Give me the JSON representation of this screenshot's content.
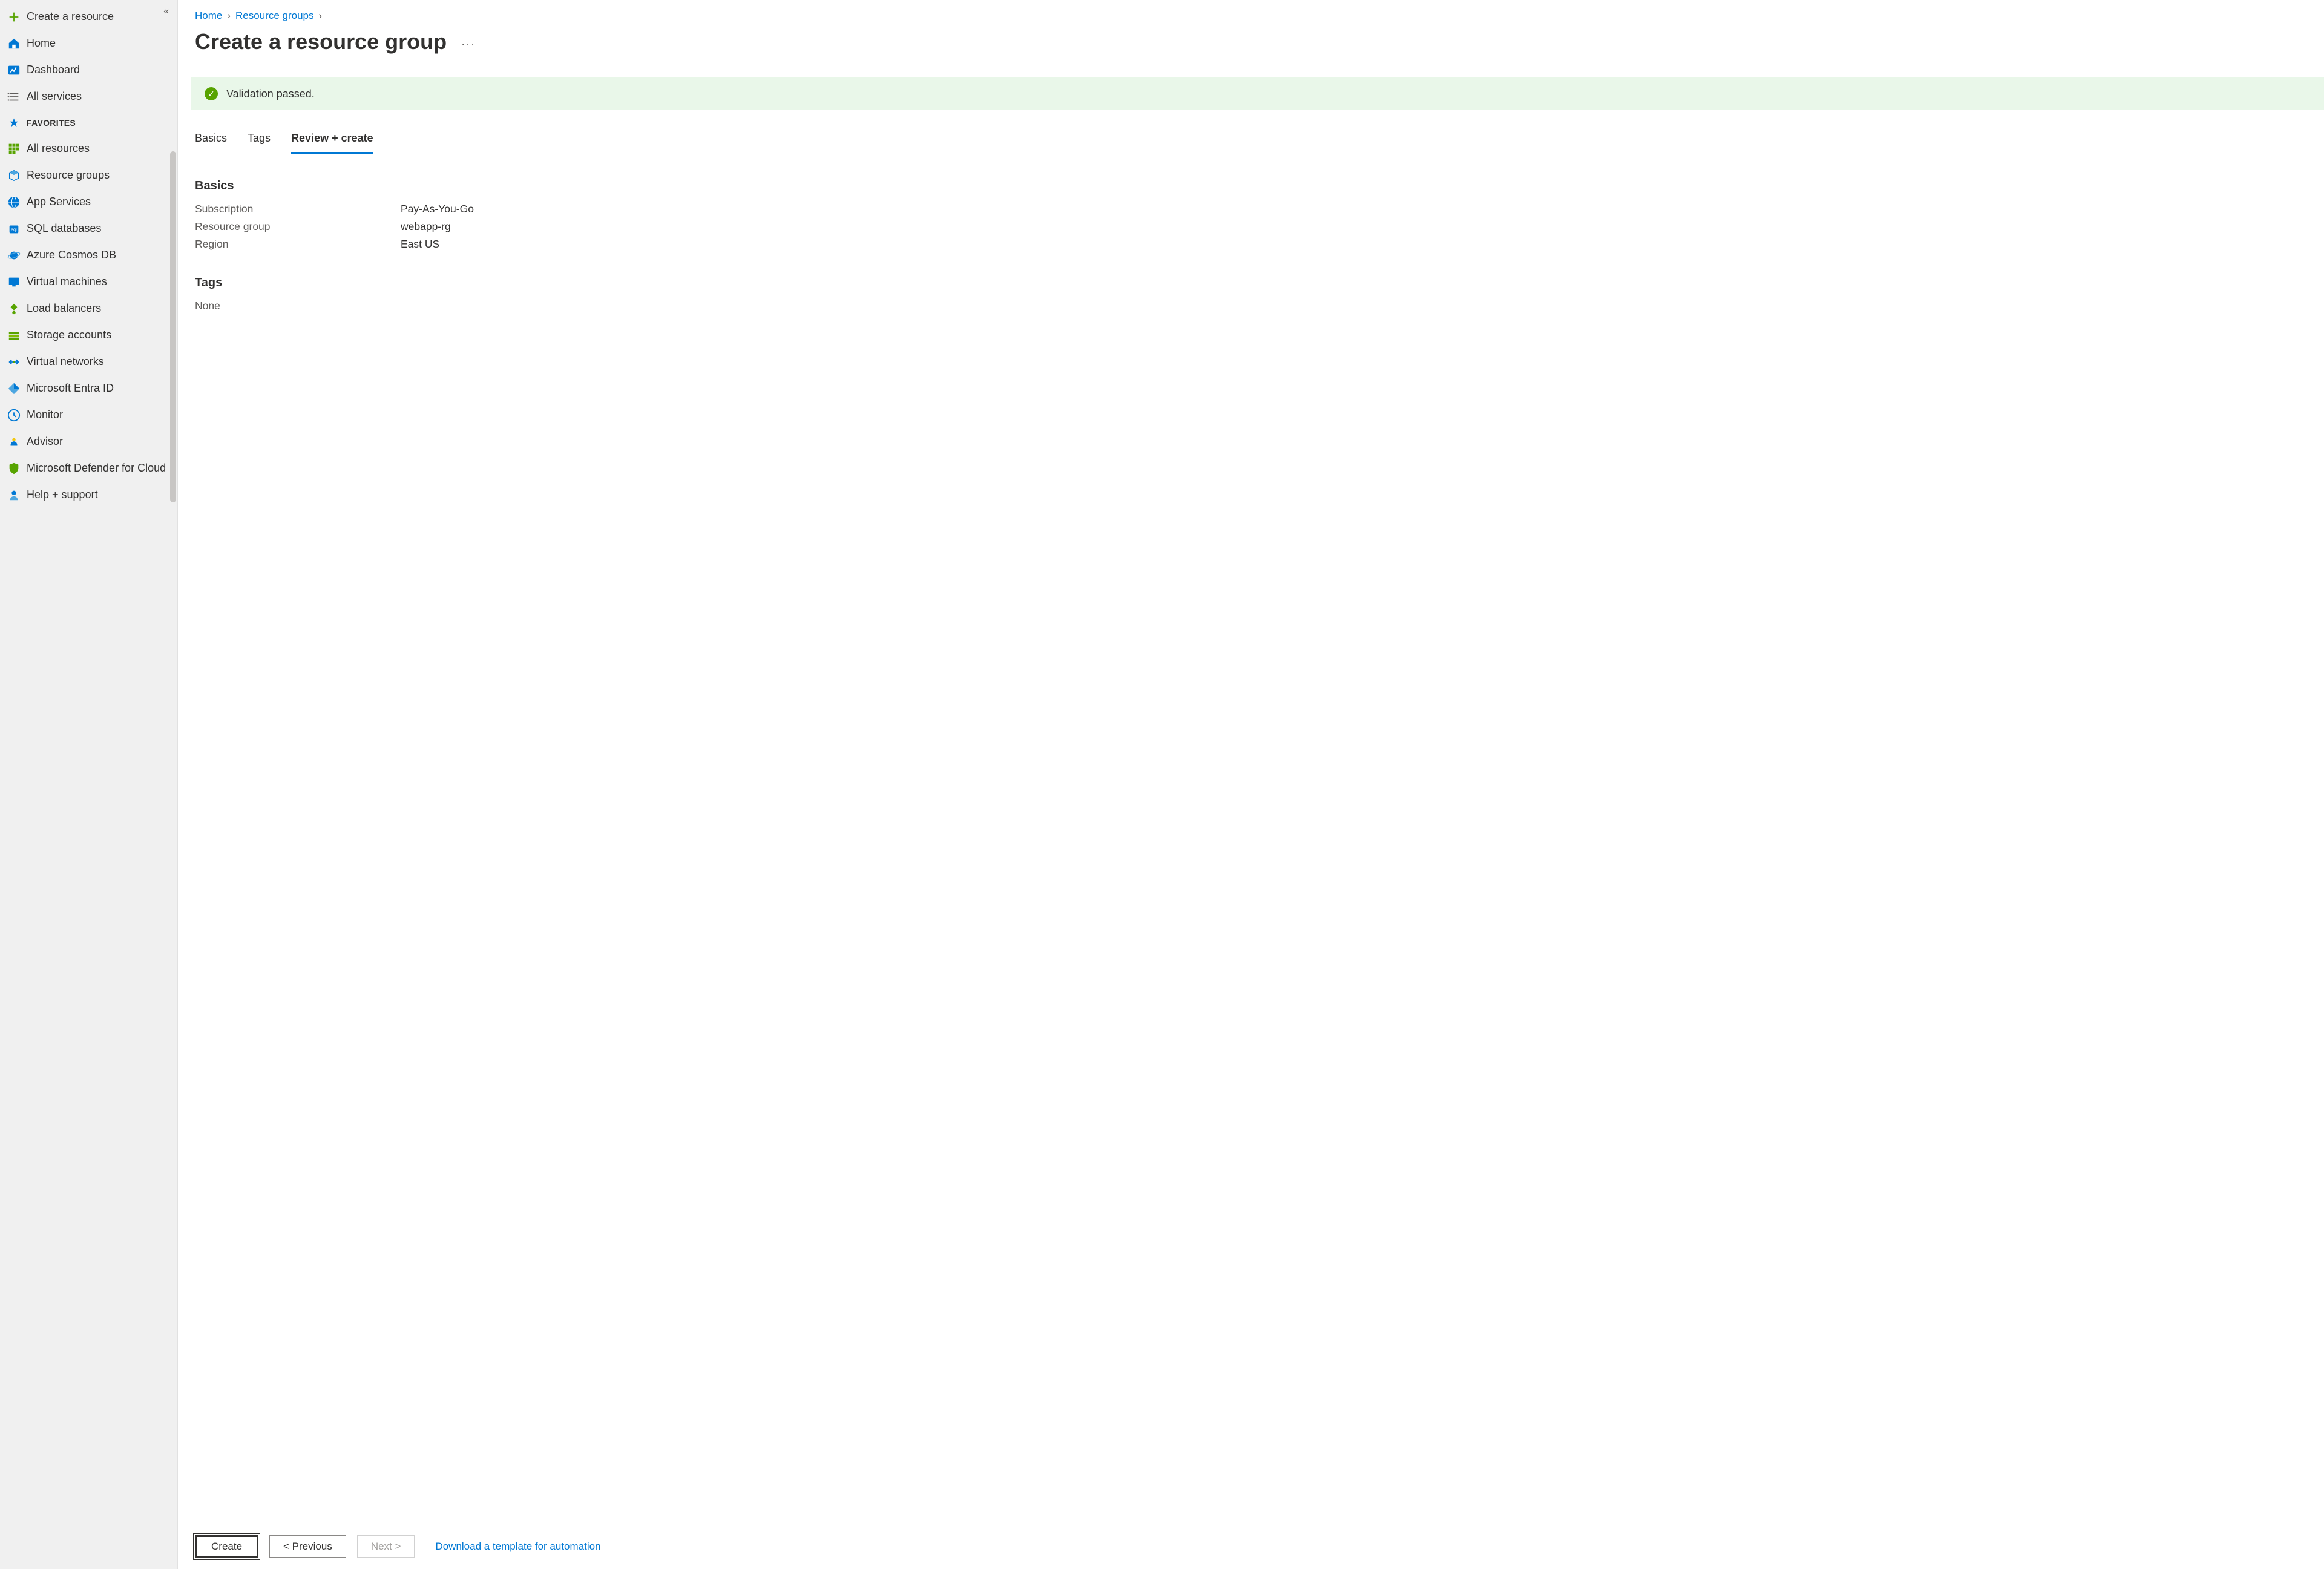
{
  "sidebar": {
    "top": [
      {
        "label": "Create a resource",
        "icon": "plus"
      },
      {
        "label": "Home",
        "icon": "home"
      },
      {
        "label": "Dashboard",
        "icon": "dashboard"
      },
      {
        "label": "All services",
        "icon": "list"
      }
    ],
    "favorites_label": "FAVORITES",
    "favorites": [
      {
        "label": "All resources",
        "icon": "grid-green"
      },
      {
        "label": "Resource groups",
        "icon": "cube-blue"
      },
      {
        "label": "App Services",
        "icon": "globe"
      },
      {
        "label": "SQL databases",
        "icon": "sql"
      },
      {
        "label": "Azure Cosmos DB",
        "icon": "cosmos"
      },
      {
        "label": "Virtual machines",
        "icon": "vm"
      },
      {
        "label": "Load balancers",
        "icon": "lb"
      },
      {
        "label": "Storage accounts",
        "icon": "storage"
      },
      {
        "label": "Virtual networks",
        "icon": "vnet"
      },
      {
        "label": "Microsoft Entra ID",
        "icon": "entra"
      },
      {
        "label": "Monitor",
        "icon": "monitor"
      },
      {
        "label": "Advisor",
        "icon": "advisor"
      },
      {
        "label": "Microsoft Defender for Cloud",
        "icon": "defender"
      },
      {
        "label": "Help + support",
        "icon": "support"
      }
    ]
  },
  "breadcrumb": {
    "items": [
      "Home",
      "Resource groups"
    ]
  },
  "page_title": "Create a resource group",
  "validation_message": "Validation passed.",
  "tabs": {
    "items": [
      "Basics",
      "Tags",
      "Review + create"
    ],
    "active_index": 2
  },
  "review": {
    "basics_heading": "Basics",
    "rows": [
      {
        "label": "Subscription",
        "value": "Pay-As-You-Go"
      },
      {
        "label": "Resource group",
        "value": "webapp-rg"
      },
      {
        "label": "Region",
        "value": "East US"
      }
    ],
    "tags_heading": "Tags",
    "tags_none": "None"
  },
  "footer": {
    "create": "Create",
    "previous": "< Previous",
    "next": "Next >",
    "download_link": "Download a template for automation"
  }
}
